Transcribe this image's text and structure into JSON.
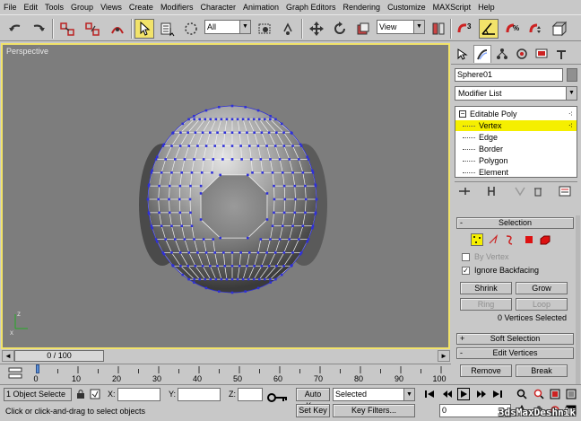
{
  "menu": [
    "File",
    "Edit",
    "Tools",
    "Group",
    "Views",
    "Create",
    "Modifiers",
    "Character",
    "Animation",
    "Graph Editors",
    "Rendering",
    "Customize",
    "MAXScript",
    "Help"
  ],
  "toolbar": {
    "selection_filter": "All",
    "ref_coord": "View",
    "snap_label": "3"
  },
  "viewport": {
    "label": "Perspective",
    "axis_x": "x",
    "axis_z": "z"
  },
  "command_panel": {
    "object_name": "Sphere01",
    "modifier_list": "Modifier List",
    "stack": {
      "root": "Editable Poly",
      "items": [
        "Vertex",
        "Edge",
        "Border",
        "Polygon",
        "Element"
      ],
      "selected": "Vertex"
    },
    "selection": {
      "title": "Selection",
      "by_vertex": "By Vertex",
      "ignore_backfacing": "Ignore Backfacing",
      "ignore_backfacing_checked": true,
      "by_vertex_checked": false,
      "shrink": "Shrink",
      "grow": "Grow",
      "ring": "Ring",
      "loop": "Loop",
      "status": "0 Vertices Selected"
    },
    "soft_selection": "Soft Selection",
    "edit_vertices": {
      "title": "Edit Vertices",
      "remove": "Remove",
      "break": "Break"
    },
    "sign_plus": "+",
    "sign_minus": "-"
  },
  "timeline": {
    "frame_readout": "0 / 100",
    "ticks": [
      "0",
      "10",
      "20",
      "30",
      "40",
      "50",
      "60",
      "70",
      "80",
      "90",
      "100"
    ]
  },
  "status": {
    "selection_count": "1 Object Selecte",
    "prompt": "Click or click-and-drag to select objects",
    "x_label": "X:",
    "y_label": "Y:",
    "z_label": "Z:",
    "auto_key": "Auto Key",
    "set_key": "Set Key",
    "key_mode": "Selected",
    "key_filters": "Key Filters...",
    "current_frame": "0"
  },
  "watermark": "3dsMaxDeshnik",
  "colors": {
    "viewport_bg": "#7d7d7d",
    "active_border": "#f2e36a",
    "selection_yellow": "#f5ef00",
    "vertex_blue": "#2f30d8"
  }
}
